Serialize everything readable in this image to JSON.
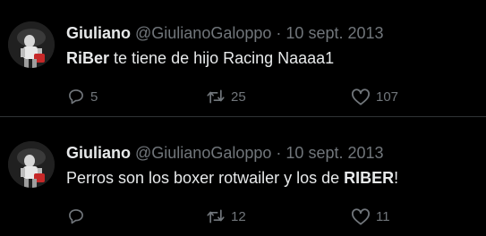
{
  "colors": {
    "background": "#000000",
    "text_primary": "#e7e9ea",
    "text_secondary": "#71767b",
    "divider": "#2f3336"
  },
  "tweets": [
    {
      "author_name": "Giuliano",
      "handle": "@GiulianoGaloppo",
      "separator": "·",
      "date": "10 sept. 2013",
      "text_bold": "RiBer",
      "text_rest": " te tiene de hijo Racing Naaaa1",
      "reply_count": "5",
      "retweet_count": "25",
      "like_count": "107",
      "icons": [
        "reply-icon",
        "retweet-icon",
        "like-icon"
      ]
    },
    {
      "author_name": "Giuliano",
      "handle": "@GiulianoGaloppo",
      "separator": "·",
      "date": "10 sept. 2013",
      "text_rest": "Perros son los boxer rotwailer y los de ",
      "text_bold": "RIBER",
      "text_end": "!",
      "reply_count": "",
      "retweet_count": "12",
      "like_count": "11",
      "icons": [
        "reply-icon",
        "retweet-icon",
        "like-icon"
      ]
    }
  ]
}
